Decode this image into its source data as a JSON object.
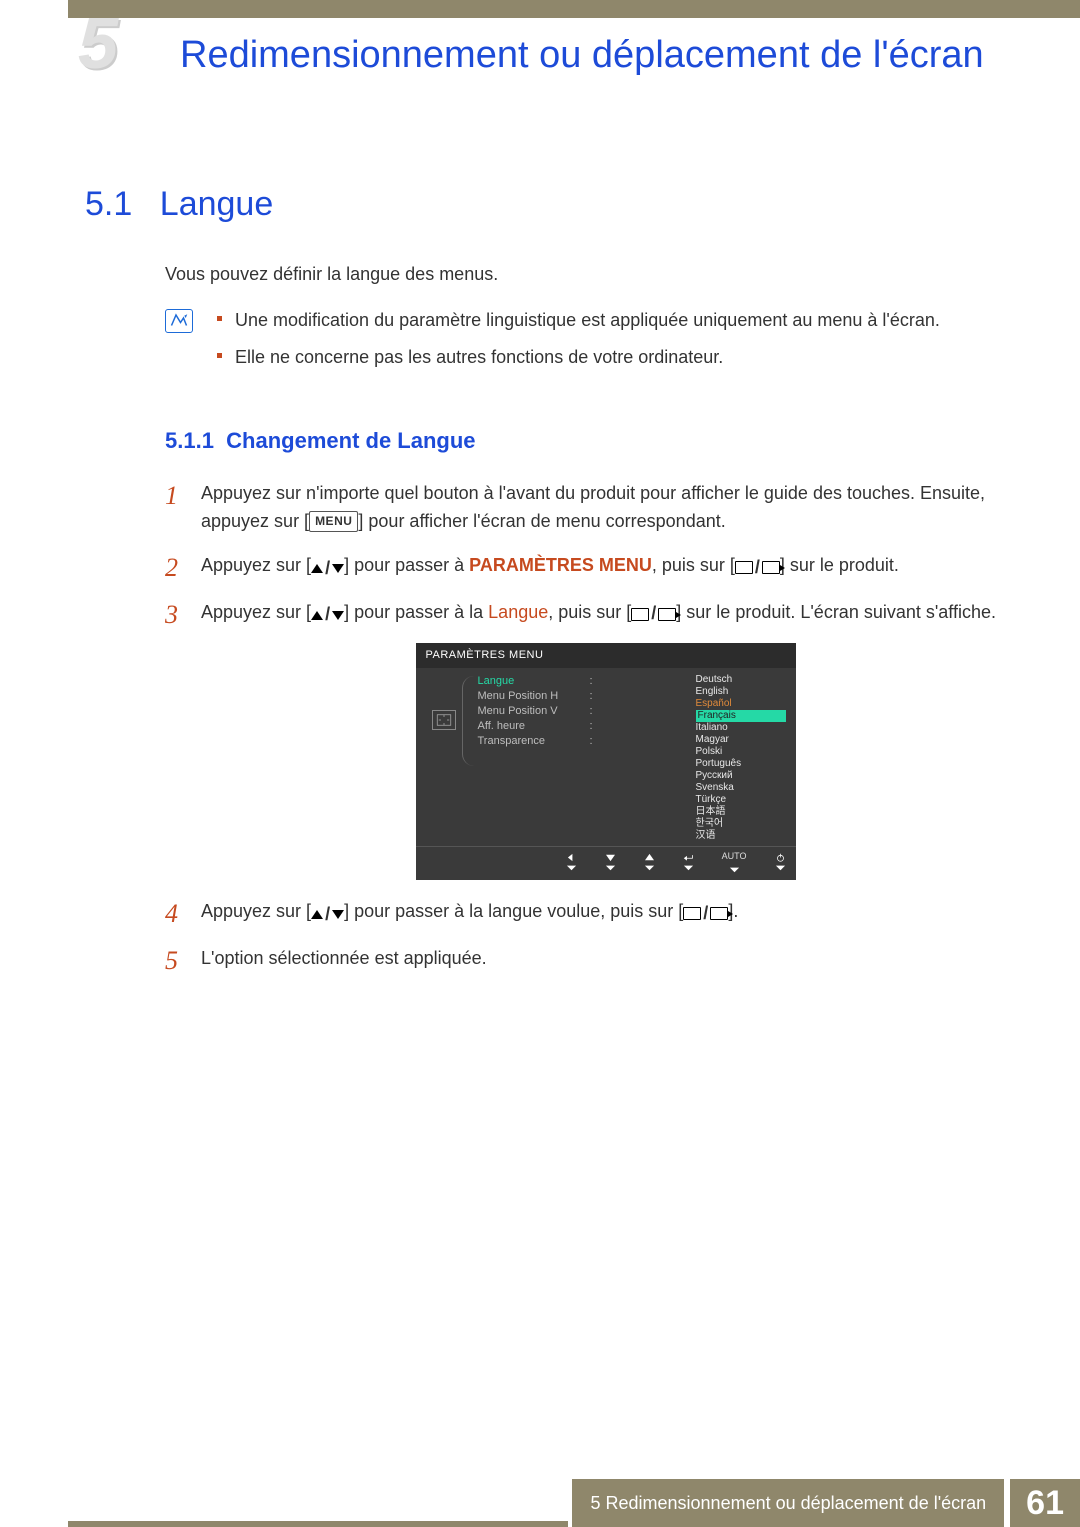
{
  "chapter_number": "5",
  "page_title": "Redimensionnement ou déplacement de l'écran",
  "section": {
    "number": "5.1",
    "title": "Langue"
  },
  "intro": "Vous pouvez définir la langue des menus.",
  "notes": [
    "Une modification du paramètre linguistique est appliquée uniquement au menu à l'écran.",
    "Elle ne concerne pas les autres fonctions de votre ordinateur."
  ],
  "subsection": {
    "number": "5.1.1",
    "title": "Changement de Langue"
  },
  "menu_button_label": "MENU",
  "steps": {
    "s1a": "Appuyez sur n'importe quel bouton à l'avant du produit pour afficher le guide des touches. Ensuite, appuyez sur [",
    "s1b": "] pour afficher l'écran de menu correspondant.",
    "s2a": "Appuyez sur [",
    "s2b": "] pour passer à ",
    "s2c": "PARAMÈTRES MENU",
    "s2d": ", puis sur [",
    "s2e": "] sur le produit.",
    "s3a": "Appuyez sur [",
    "s3b": "] pour passer à la ",
    "s3c": "Langue",
    "s3d": ", puis sur [",
    "s3e": "] sur le produit. L'écran suivant s'affiche.",
    "s4a": "Appuyez sur [",
    "s4b": "] pour passer à la langue voulue, puis sur [",
    "s4c": "].",
    "s5": "L'option sélectionnée est appliquée."
  },
  "osd": {
    "title": "PARAMÈTRES MENU",
    "items": [
      {
        "label": "Langue",
        "active": true
      },
      {
        "label": "Menu Position H"
      },
      {
        "label": "Menu Position V"
      },
      {
        "label": "Aff. heure"
      },
      {
        "label": "Transparence"
      }
    ],
    "languages": [
      "Deutsch",
      "English",
      "Español",
      "Français",
      "Italiano",
      "Magyar",
      "Polski",
      "Português",
      "Русский",
      "Svenska",
      "Türkçe",
      "日本語",
      "한국어",
      "汉语"
    ],
    "selected_language_index": 3,
    "footer_auto": "AUTO"
  },
  "footer": {
    "label": "5 Redimensionnement ou déplacement de l'écran",
    "page": "61"
  }
}
